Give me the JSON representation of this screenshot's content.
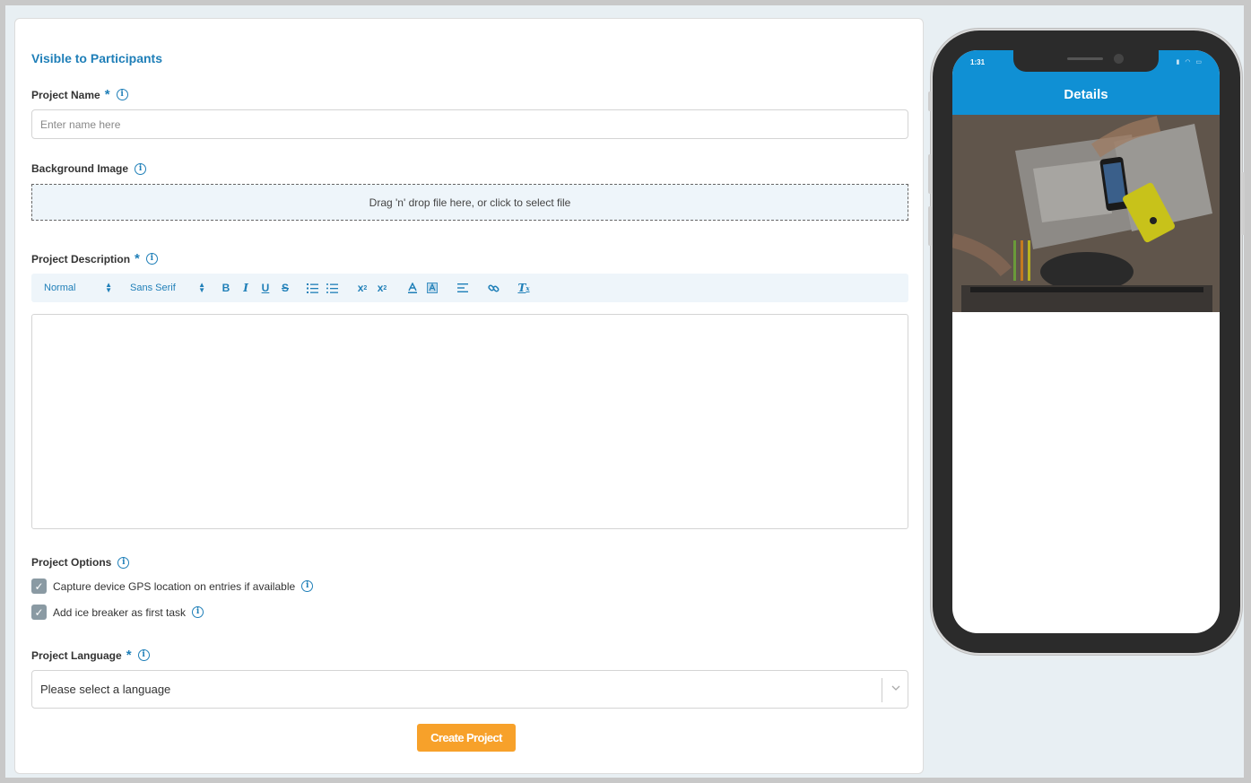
{
  "form": {
    "section_title": "Visible to Participants",
    "project_name": {
      "label": "Project Name",
      "placeholder": "Enter name here",
      "value": ""
    },
    "background_image": {
      "label": "Background Image",
      "dropzone_text": "Drag 'n' drop file here, or click to select file"
    },
    "project_description": {
      "label": "Project Description",
      "toolbar": {
        "size": "Normal",
        "font": "Sans Serif",
        "bold": "B",
        "italic": "I",
        "underline": "U",
        "strike": "S",
        "subscript": "x",
        "subscript_sub": "2",
        "superscript": "x",
        "superscript_sup": "2",
        "clear": "T",
        "clear_sub": "x"
      },
      "content": ""
    },
    "project_options": {
      "label": "Project Options",
      "items": [
        {
          "label": "Capture device GPS location on entries if available",
          "checked": true
        },
        {
          "label": "Add ice breaker as first task",
          "checked": true
        }
      ]
    },
    "project_language": {
      "label": "Project Language",
      "placeholder": "Please select a language"
    },
    "submit_label": "Create Project",
    "required_mark": "*",
    "info_glyph": "i"
  },
  "preview": {
    "status_time": "1:31",
    "title": "Details",
    "image_icon": "workspace-photo"
  },
  "colors": {
    "accent": "#1f7fb8",
    "button": "#f7a12a",
    "phone_header": "#1090d4"
  }
}
